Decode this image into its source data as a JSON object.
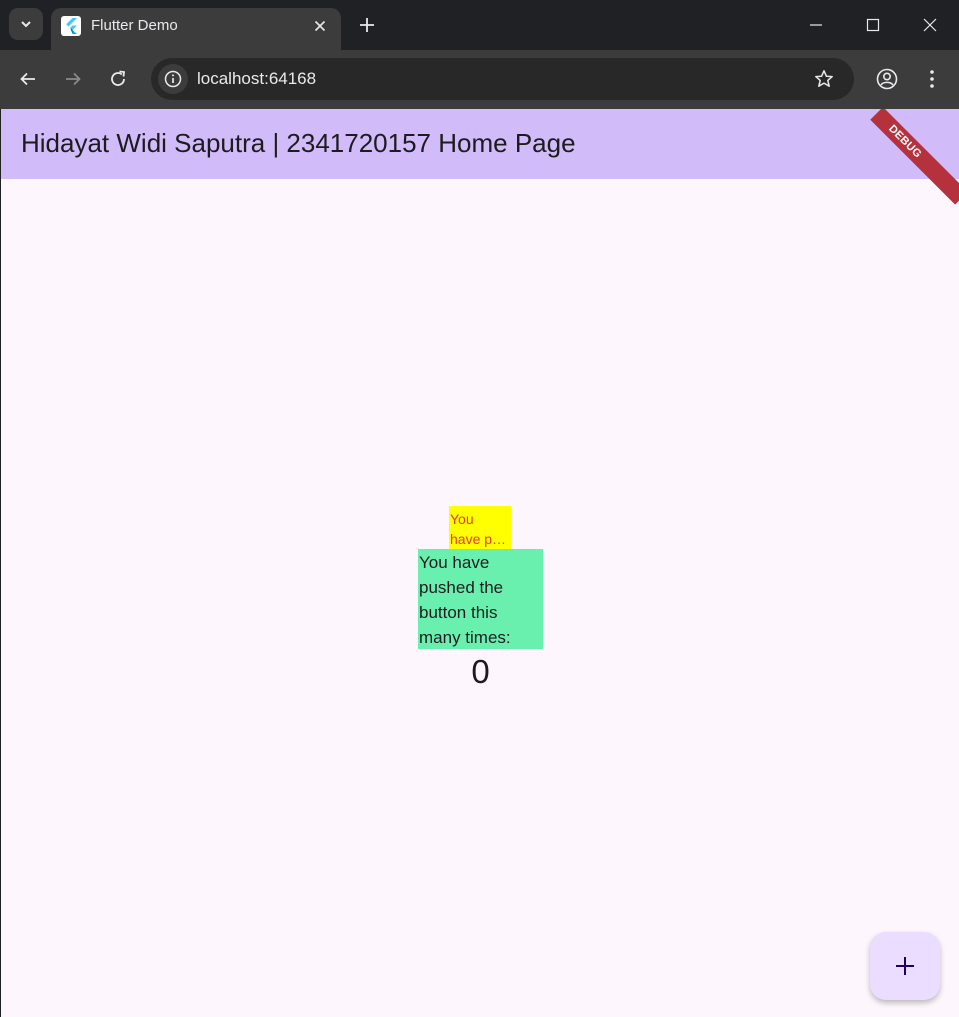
{
  "browser": {
    "tab": {
      "title": "Flutter Demo",
      "favicon": "flutter-logo-icon"
    },
    "url": "localhost:64168",
    "icons": [
      "tab-search-icon",
      "close-icon",
      "plus-icon",
      "minimize-icon",
      "maximize-icon",
      "close-window-icon",
      "back-icon",
      "forward-icon",
      "reload-icon",
      "site-info-icon",
      "star-icon",
      "profile-icon",
      "menu-icon"
    ]
  },
  "app": {
    "title": "Hidayat Widi Saputra | 2341720157 Home Page",
    "debug_banner": "DEBUG",
    "yellow_text": {
      "line1": "You",
      "line2": "have p…"
    },
    "green_text": {
      "line1": "You have",
      "line2": "pushed the",
      "line3": "button this",
      "line4": "many times:"
    },
    "counter": "0",
    "fab_icon": "add-icon"
  },
  "colors": {
    "appbar": "#d1bcf9",
    "background": "#fdf7fd",
    "yellow_box": "#ffff00",
    "yellow_text": "#e53935",
    "green_box": "#69f0ae",
    "fab": "#eaddff",
    "debug_banner": "#b5323c"
  }
}
